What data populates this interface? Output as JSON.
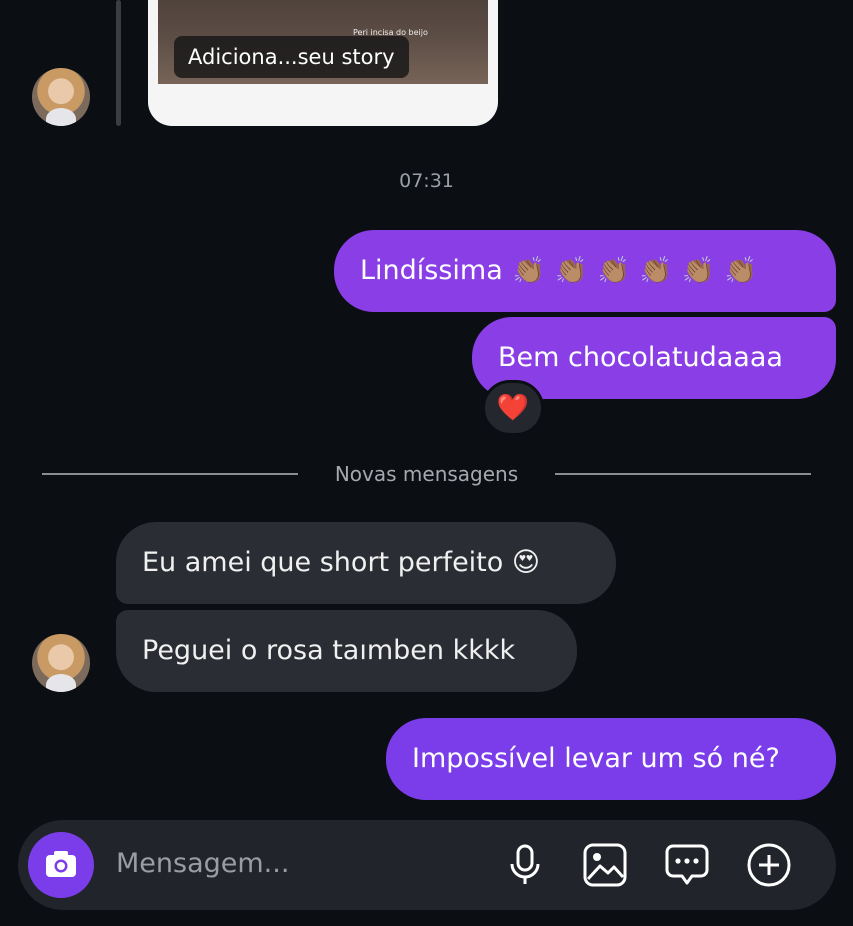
{
  "story": {
    "small_caption": "Peri incisa do beijo",
    "caption": "Adiciona...seu story"
  },
  "timestamp": "07:31",
  "sent_1": {
    "text": "Lindíssima",
    "claps": [
      "👏🏽",
      "👏🏽",
      "👏🏽",
      "👏🏽",
      "👏🏽",
      "👏🏽"
    ]
  },
  "sent_2": {
    "text": "Bem chocolatudaaaa",
    "reaction": "❤️"
  },
  "divider": {
    "label": "Novas mensagens"
  },
  "received": [
    {
      "text": "Eu amei que short perfeito 😍"
    },
    {
      "text": "Peguei o rosa taımben kkkk"
    }
  ],
  "sent_3": {
    "text": "Impossível levar um só né?"
  },
  "composer": {
    "placeholder": "Mensagem...",
    "icons": [
      "camera-icon",
      "microphone-icon",
      "gallery-icon",
      "sticker-chat-icon",
      "plus-circle-icon"
    ]
  },
  "colors": {
    "background": "#0b0f14",
    "sent_bubble": "#8a3ee6",
    "received_bubble": "#2a2d33",
    "accent": "#7b3dea"
  }
}
